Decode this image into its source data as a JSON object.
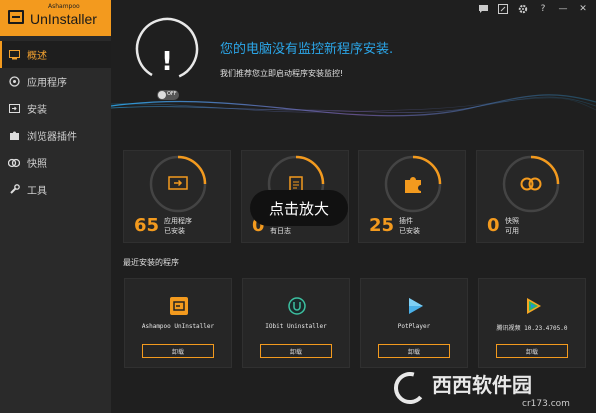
{
  "app": {
    "brand": "Ashampoo",
    "title": "UnInstaller"
  },
  "titlebar": {
    "icons": [
      "chat-icon",
      "edit-icon",
      "gear-icon",
      "help-icon",
      "minimize-icon",
      "close-icon"
    ],
    "help_label": "?",
    "minimize_label": "—",
    "close_label": "✕"
  },
  "sidebar": {
    "items": [
      {
        "label": "概述",
        "icon": "monitor-icon",
        "active": true
      },
      {
        "label": "应用程序",
        "icon": "apps-icon",
        "active": false
      },
      {
        "label": "安装",
        "icon": "install-icon",
        "active": false
      },
      {
        "label": "浏览器插件",
        "icon": "puzzle-icon",
        "active": false
      },
      {
        "label": "快照",
        "icon": "snapshot-icon",
        "active": false
      },
      {
        "label": "工具",
        "icon": "tools-icon",
        "active": false
      }
    ]
  },
  "hero": {
    "alert_symbol": "!",
    "toggle_label": "OFF",
    "title": "您的电脑没有监控新程序安装.",
    "subtitle": "我们推荐您立即启动程序安装监控!"
  },
  "stats": [
    {
      "number": "65",
      "line1": "应用程序",
      "line2": "已安装",
      "icon": "install-icon"
    },
    {
      "number": "0",
      "line1": "",
      "line2": "有日志",
      "icon": "clipboard-icon"
    },
    {
      "number": "25",
      "line1": "插件",
      "line2": "已安装",
      "icon": "puzzle-icon"
    },
    {
      "number": "0",
      "line1": "快照",
      "line2": "可用",
      "icon": "snapshot-icon"
    }
  ],
  "overlay": {
    "label": "点击放大"
  },
  "recent": {
    "title": "最近安装的程序",
    "programs": [
      {
        "name": "Ashampoo UnInstaller",
        "button": "卸载",
        "icon": "ashampoo-uninstaller-icon"
      },
      {
        "name": "IObit Uninstaller",
        "button": "卸载",
        "icon": "iobit-uninstaller-icon"
      },
      {
        "name": "PotPlayer",
        "button": "卸载",
        "icon": "potplayer-icon"
      },
      {
        "name": "腾讯视频 10.23.4705.0",
        "button": "卸载",
        "icon": "tencent-video-icon"
      }
    ]
  },
  "watermark": {
    "text": "西西软件园",
    "url": "cr173.com"
  },
  "colors": {
    "accent": "#f39a1e",
    "highlight": "#2ba6e8",
    "background": "#1f1f1f",
    "sidebar": "#2a2a2a"
  }
}
